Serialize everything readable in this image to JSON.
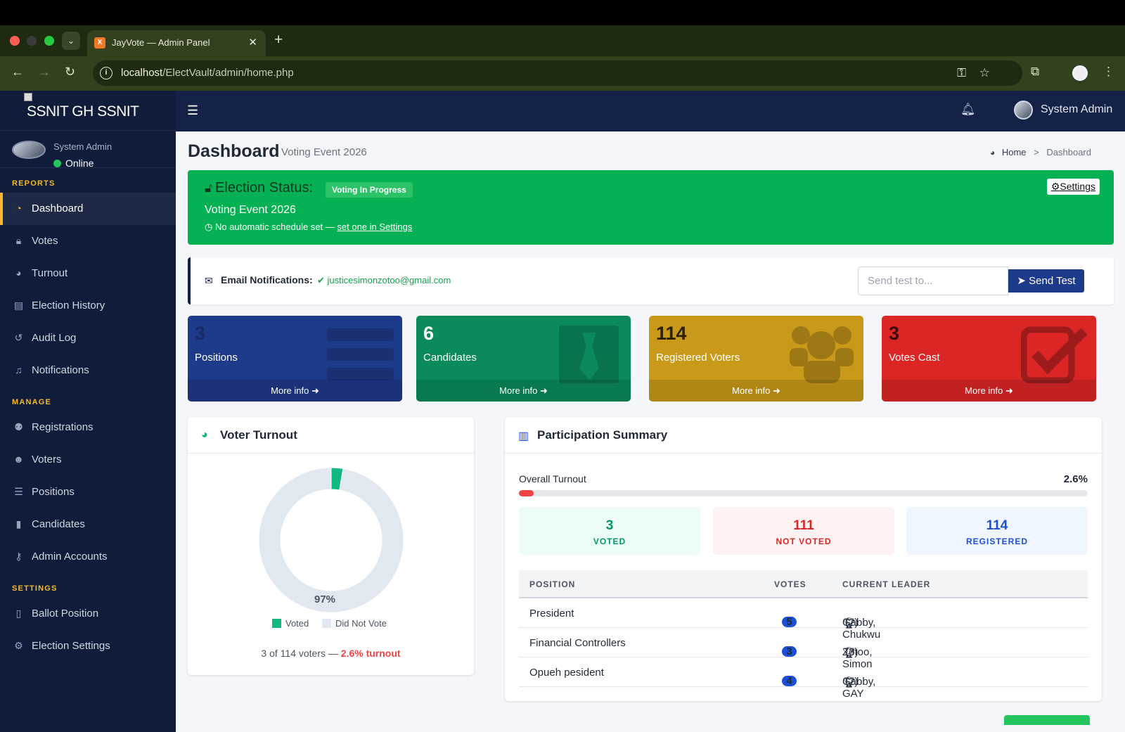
{
  "browser": {
    "tab_title": "JayVote — Admin Panel",
    "tab_favicon": "X",
    "url_host": "localhost",
    "url_path": "/ElectVault/admin/home.php"
  },
  "brand": {
    "text": "SSNIT GH  SSNIT"
  },
  "user": {
    "name": "System Admin",
    "status": "Online"
  },
  "sidebar": {
    "reports_label": "REPORTS",
    "manage_label": "MANAGE",
    "settings_label": "SETTINGS",
    "reports": [
      {
        "label": "Dashboard",
        "icon": "dashboard-icon"
      },
      {
        "label": "Votes",
        "icon": "lock-icon"
      },
      {
        "label": "Turnout",
        "icon": "pie-chart-icon"
      },
      {
        "label": "Election History",
        "icon": "archive-icon"
      },
      {
        "label": "Audit Log",
        "icon": "history-icon"
      },
      {
        "label": "Notifications",
        "icon": "bell-icon"
      }
    ],
    "manage": [
      {
        "label": "Registrations",
        "icon": "user-plus-icon"
      },
      {
        "label": "Voters",
        "icon": "users-icon"
      },
      {
        "label": "Positions",
        "icon": "list-icon"
      },
      {
        "label": "Candidates",
        "icon": "id-badge-icon"
      },
      {
        "label": "Admin Accounts",
        "icon": "user-lock-icon"
      }
    ],
    "settings": [
      {
        "label": "Ballot Position",
        "icon": "file-icon"
      },
      {
        "label": "Election Settings",
        "icon": "gear-icon"
      }
    ]
  },
  "navbar": {
    "user": "System Admin"
  },
  "page": {
    "title": "Dashboard",
    "subtitle": "Voting Event 2026",
    "breadcrumb_home": "Home",
    "breadcrumb_current": "Dashboard"
  },
  "status": {
    "title": "Election Status:",
    "badge": "Voting In Progress",
    "event": "Voting Event 2026",
    "schedule_text": "No automatic schedule set — ",
    "schedule_link": "set one in Settings",
    "settings_button": "Settings"
  },
  "email": {
    "label": "Email Notifications:",
    "address": "justicesimonzotoo@gmail.com",
    "placeholder": "Send test to...",
    "button": "Send Test"
  },
  "boxes": [
    {
      "value": "3",
      "label": "Positions",
      "more": "More info",
      "color": "#1e3a8a",
      "icon": "list-icon"
    },
    {
      "value": "6",
      "label": "Candidates",
      "more": "More info",
      "color": "#0b8a5c",
      "icon": "id-badge-icon"
    },
    {
      "value": "114",
      "label": "Registered Voters",
      "more": "More info",
      "color": "#c99a1a",
      "icon": "users-icon"
    },
    {
      "value": "3",
      "label": "Votes Cast",
      "more": "More info",
      "color": "#dc2626",
      "icon": "check-square-icon"
    }
  ],
  "turnout_card": {
    "title": "Voter Turnout",
    "center_label": "97%",
    "legend_voted": "Voted",
    "legend_not": "Did Not Vote",
    "footer_prefix": "3 of 114 voters — ",
    "footer_highlight": "2.6% turnout"
  },
  "participation": {
    "title": "Participation Summary",
    "overall_label": "Overall Turnout",
    "overall_value": "2.6%",
    "overall_fraction": 0.026,
    "voted": "3",
    "voted_label": "VOTED",
    "not_voted": "111",
    "not_voted_label": "NOT VOTED",
    "registered": "114",
    "registered_label": "REGISTERED",
    "headers": {
      "position": "POSITION",
      "votes": "VOTES",
      "leader": "CURRENT LEADER"
    },
    "rows": [
      {
        "position": "President",
        "votes": "5",
        "leader": "Gabby, Chukwu",
        "count": "(2)"
      },
      {
        "position": "Financial Controllers",
        "votes": "3",
        "leader": "Zotoo, Simon",
        "count": "(3)"
      },
      {
        "position": "Opueh pesident",
        "votes": "4",
        "leader": "Gabby, GAY",
        "count": "(2)"
      }
    ]
  },
  "chart_data": {
    "type": "pie",
    "categories": [
      "Voted",
      "Did Not Vote"
    ],
    "values": [
      3,
      111
    ],
    "colors": [
      "#10b981",
      "#e2e8f0"
    ]
  }
}
